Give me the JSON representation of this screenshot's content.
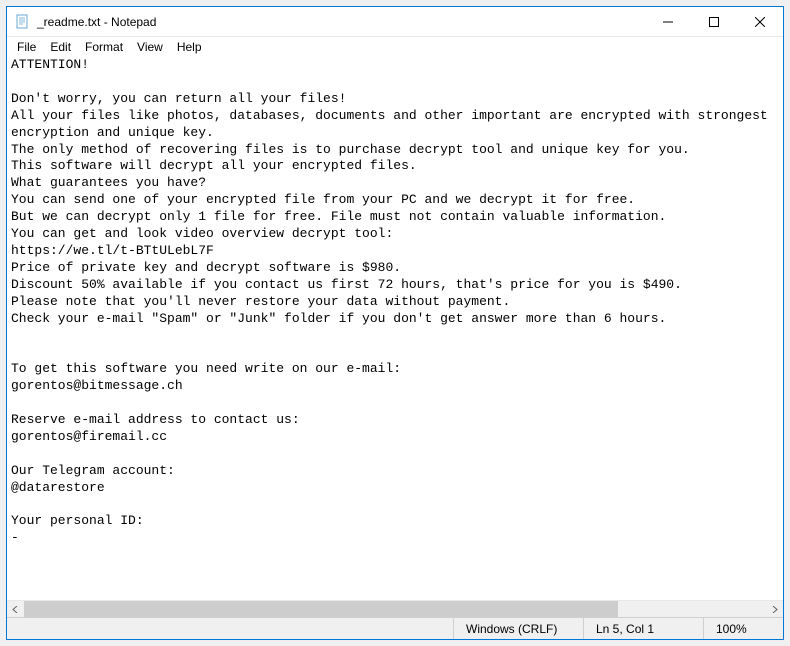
{
  "window": {
    "title": "_readme.txt - Notepad"
  },
  "menu": {
    "file": "File",
    "edit": "Edit",
    "format": "Format",
    "view": "View",
    "help": "Help"
  },
  "document": {
    "text": "ATTENTION!\n\nDon't worry, you can return all your files!\nAll your files like photos, databases, documents and other important are encrypted with strongest encryption and unique key.\nThe only method of recovering files is to purchase decrypt tool and unique key for you.\nThis software will decrypt all your encrypted files.\nWhat guarantees you have?\nYou can send one of your encrypted file from your PC and we decrypt it for free.\nBut we can decrypt only 1 file for free. File must not contain valuable information.\nYou can get and look video overview decrypt tool:\nhttps://we.tl/t-BTtULebL7F\nPrice of private key and decrypt software is $980.\nDiscount 50% available if you contact us first 72 hours, that's price for you is $490.\nPlease note that you'll never restore your data without payment.\nCheck your e-mail \"Spam\" or \"Junk\" folder if you don't get answer more than 6 hours.\n\n\nTo get this software you need write on our e-mail:\ngorentos@bitmessage.ch\n\nReserve e-mail address to contact us:\ngorentos@firemail.cc\n\nOur Telegram account:\n@datarestore\n\nYour personal ID:\n-"
  },
  "statusbar": {
    "encoding": "Windows (CRLF)",
    "position": "Ln 5, Col 1",
    "zoom": "100%"
  }
}
